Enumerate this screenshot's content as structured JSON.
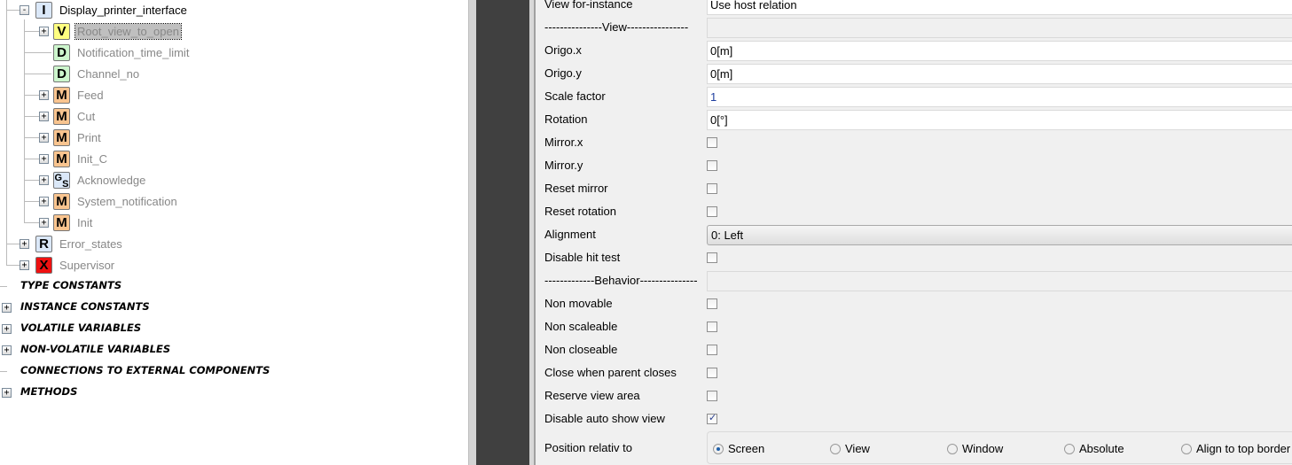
{
  "tree": {
    "root": {
      "icon": "I",
      "label": "Display_printer_interface",
      "icon_color": "#dbe8f8"
    },
    "children": [
      {
        "icon": "V",
        "label": "Root_view_to_open",
        "icon_color": "#ffff80",
        "expandable": true,
        "selected": true
      },
      {
        "icon": "D",
        "label": "Notification_time_limit",
        "icon_color": "#ccf5cc",
        "expandable": false
      },
      {
        "icon": "D",
        "label": "Channel_no",
        "icon_color": "#ccf5cc",
        "expandable": false
      },
      {
        "icon": "M",
        "label": "Feed",
        "icon_color": "#f9c48f",
        "expandable": true
      },
      {
        "icon": "M",
        "label": "Cut",
        "icon_color": "#f9c48f",
        "expandable": true
      },
      {
        "icon": "M",
        "label": "Print",
        "icon_color": "#f9c48f",
        "expandable": true
      },
      {
        "icon": "M",
        "label": "Init_C",
        "icon_color": "#f9c48f",
        "expandable": true
      },
      {
        "icon": "GS",
        "label": "Acknowledge",
        "icon_color": "#dbe8f8",
        "expandable": true
      },
      {
        "icon": "M",
        "label": "System_notification",
        "icon_color": "#f9c48f",
        "expandable": true
      },
      {
        "icon": "M",
        "label": "Init",
        "icon_color": "#f9c48f",
        "expandable": true
      }
    ],
    "siblings": [
      {
        "icon": "R",
        "label": "Error_states",
        "icon_color": "#dbe8f8"
      },
      {
        "icon": "X",
        "label": "Supervisor",
        "icon_color": "#ee1111"
      }
    ],
    "categories": [
      {
        "label": "TYPE CONSTANTS",
        "expandable": false
      },
      {
        "label": "INSTANCE CONSTANTS",
        "expandable": true
      },
      {
        "label": "VOLATILE VARIABLES",
        "expandable": true
      },
      {
        "label": "NON-VOLATILE VARIABLES",
        "expandable": true
      },
      {
        "label": "CONNECTIONS TO EXTERNAL COMPONENTS",
        "expandable": false
      },
      {
        "label": "METHODS",
        "expandable": true
      }
    ]
  },
  "properties": [
    {
      "label": "View for-instance",
      "type": "text",
      "value": "Use host relation"
    },
    {
      "label": "---------------View----------------",
      "type": "header"
    },
    {
      "label": "Origo.x",
      "type": "text",
      "value": "0[m]"
    },
    {
      "label": "Origo.y",
      "type": "text",
      "value": "0[m]"
    },
    {
      "label": "Scale factor",
      "type": "text",
      "value": "1",
      "accent": "#1f3fa0"
    },
    {
      "label": "Rotation",
      "type": "text",
      "value": "0[°]"
    },
    {
      "label": "Mirror.x",
      "type": "checkbox",
      "checked": false
    },
    {
      "label": "Mirror.y",
      "type": "checkbox",
      "checked": false
    },
    {
      "label": "Reset mirror",
      "type": "checkbox",
      "checked": false
    },
    {
      "label": "Reset rotation",
      "type": "checkbox",
      "checked": false
    },
    {
      "label": "Alignment",
      "type": "select",
      "value": "0: Left"
    },
    {
      "label": "Disable hit test",
      "type": "checkbox",
      "checked": false
    },
    {
      "label": "-------------Behavior---------------",
      "type": "header"
    },
    {
      "label": "Non movable",
      "type": "checkbox",
      "checked": false
    },
    {
      "label": "Non scaleable",
      "type": "checkbox",
      "checked": false
    },
    {
      "label": "Non closeable",
      "type": "checkbox",
      "checked": false
    },
    {
      "label": "Close when parent closes",
      "type": "checkbox",
      "checked": false
    },
    {
      "label": "Reserve view area",
      "type": "checkbox",
      "checked": false
    },
    {
      "label": "Disable auto show view",
      "type": "checkbox",
      "checked": true
    }
  ],
  "position": {
    "label": "Position relativ to",
    "options": [
      "Screen",
      "View",
      "Window",
      "Absolute",
      "Align to top border"
    ],
    "selected": "Screen"
  }
}
